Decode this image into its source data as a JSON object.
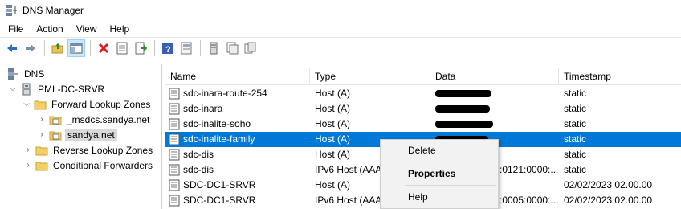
{
  "window": {
    "title": "DNS Manager"
  },
  "menu": [
    "File",
    "Action",
    "View",
    "Help"
  ],
  "toolbar": {
    "buttons": [
      "back-icon",
      "forward-icon",
      "up-folder-icon",
      "show-hide-tree-icon",
      "delete-icon",
      "properties-icon",
      "export-list-icon",
      "help-icon",
      "console-icon",
      "server-icon",
      "records-icon"
    ]
  },
  "tree": [
    {
      "label": "DNS",
      "level": 0,
      "expand": "",
      "icon": "dns-icon"
    },
    {
      "label": "PML-DC-SRVR",
      "level": 1,
      "expand": "open",
      "icon": "server-icon"
    },
    {
      "label": "Forward Lookup Zones",
      "level": 2,
      "expand": "open",
      "icon": "folder-icon"
    },
    {
      "label": "_msdcs.sandya.net",
      "level": 3,
      "expand": "closed",
      "icon": "zone-icon"
    },
    {
      "label": "sandya.net",
      "level": 3,
      "expand": "closed",
      "icon": "zone-icon",
      "selected": true
    },
    {
      "label": "Reverse Lookup Zones",
      "level": 2,
      "expand": "closed",
      "icon": "folder-icon"
    },
    {
      "label": "Conditional Forwarders",
      "level": 2,
      "expand": "closed",
      "icon": "folder-icon"
    }
  ],
  "columns": {
    "name": "Name",
    "type": "Type",
    "data": "Data",
    "timestamp": "Timestamp"
  },
  "records": [
    {
      "name": "sdc-inara-route-254",
      "type": "Host (A)",
      "data": "",
      "redacted": true,
      "timestamp": "static"
    },
    {
      "name": "sdc-inara",
      "type": "Host (A)",
      "data": "",
      "redacted": true,
      "timestamp": "static"
    },
    {
      "name": "sdc-inalite-soho",
      "type": "Host (A)",
      "data": "",
      "redacted": true,
      "timestamp": "static"
    },
    {
      "name": "sdc-inalite-family",
      "type": "Host (A)",
      "data": "",
      "redacted": true,
      "timestamp": "static",
      "selected": true
    },
    {
      "name": "sdc-dis",
      "type": "Host (A)",
      "data": "",
      "redacted": false,
      "timestamp": "static"
    },
    {
      "name": "sdc-dis",
      "type": "IPv6 Host (AAA",
      "data": ":0121:0000:...",
      "redacted": false,
      "timestamp": "static"
    },
    {
      "name": "SDC-DC1-SRVR",
      "type": "Host (A)",
      "data": "",
      "redacted": false,
      "timestamp": "02/02/2023 02.00.00"
    },
    {
      "name": "SDC-DC1-SRVR",
      "type": "IPv6 Host (AAA",
      "data": ":0005:0000:...",
      "redacted": false,
      "timestamp": "02/02/2023 02.00.00"
    }
  ],
  "context_menu": {
    "items": [
      {
        "label": "Delete",
        "bold": false
      },
      {
        "label": "Properties",
        "bold": true
      },
      {
        "label": "Help",
        "bold": false
      }
    ]
  }
}
